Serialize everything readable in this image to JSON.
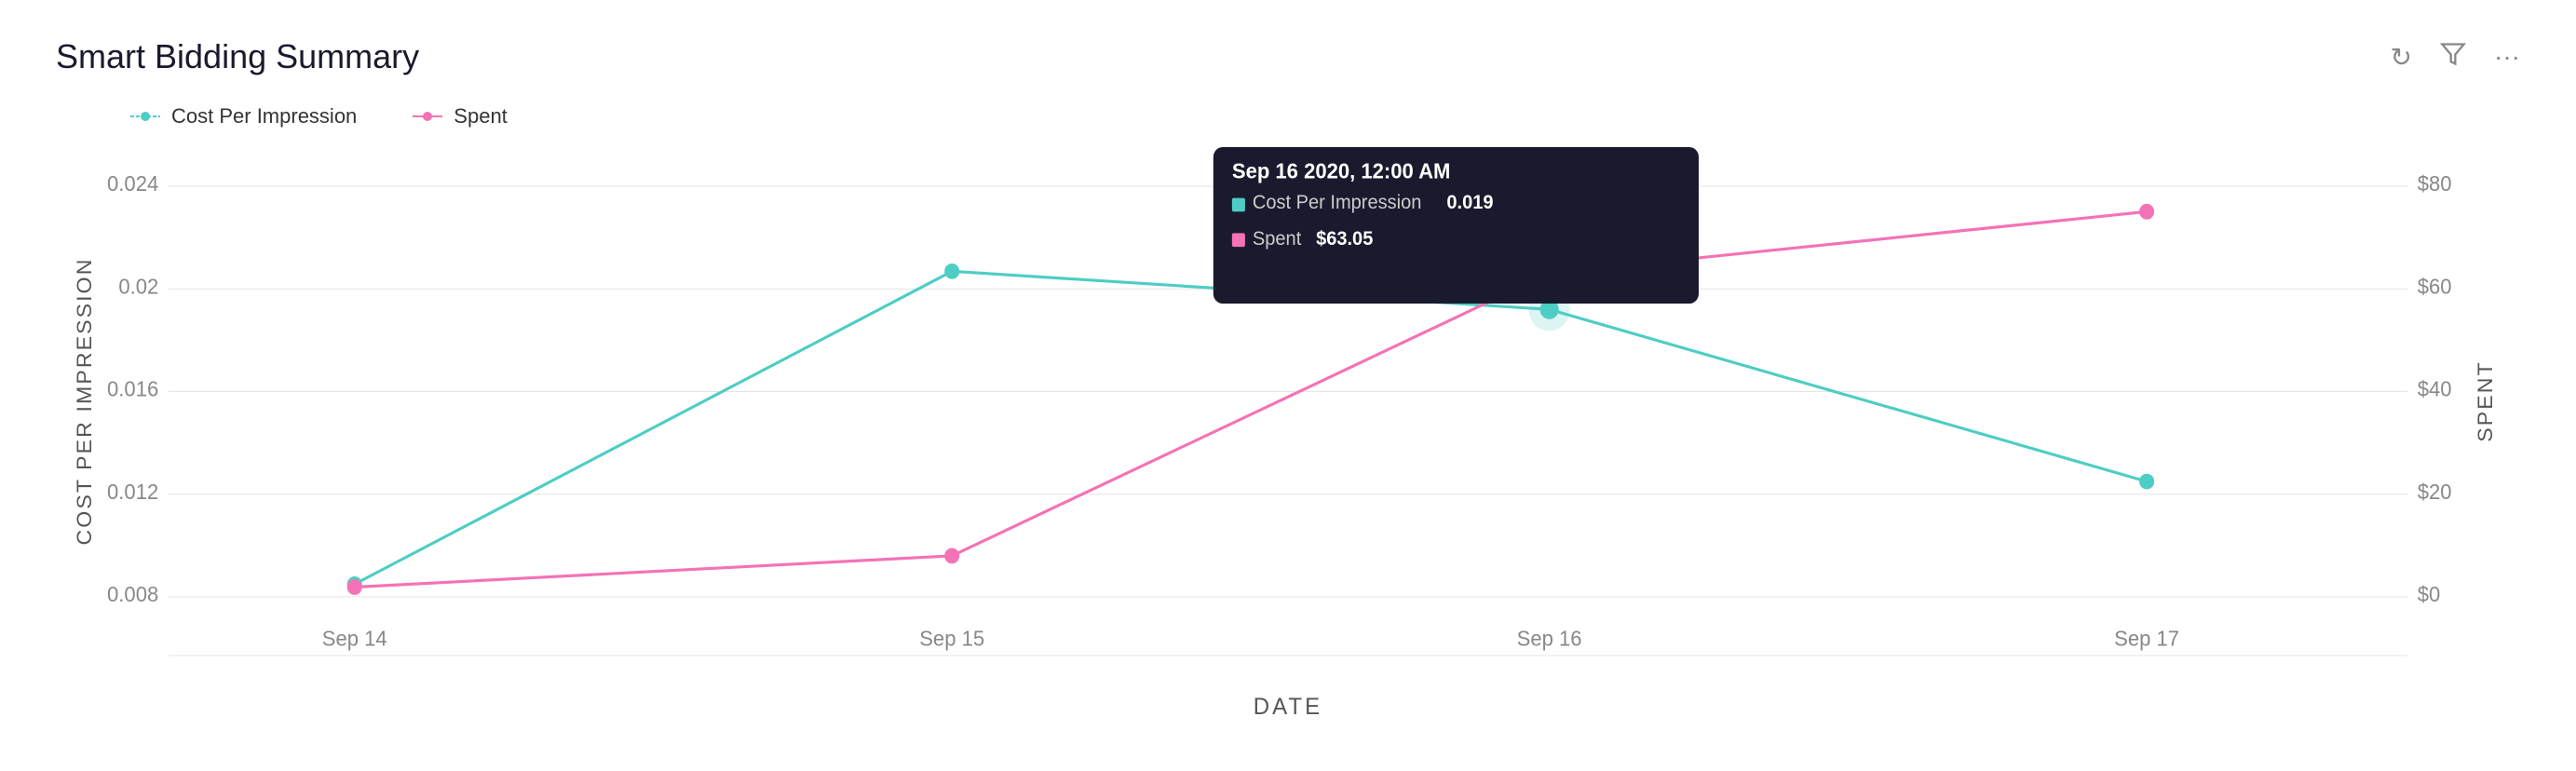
{
  "header": {
    "title": "Smart Bidding Summary"
  },
  "icons": {
    "refresh": "↻",
    "filter": "⊻",
    "more": "···"
  },
  "legend": {
    "items": [
      {
        "label": "Cost Per Impression",
        "color": "#4ecdc4"
      },
      {
        "label": "Spent",
        "color": "#f472b6"
      }
    ]
  },
  "axes": {
    "xLabel": "DATE",
    "yLeftLabel": "COST PER IMPRESSION",
    "yRightLabel": "SPENT",
    "xTicks": [
      "Sep 14",
      "Sep 15",
      "Sep 16",
      "Sep 17"
    ],
    "yLeftTicks": [
      "0.008",
      "0.012",
      "0.016",
      "0.02",
      "0.024"
    ],
    "yRightTicks": [
      "$0",
      "$20",
      "$40",
      "$60",
      "$80"
    ]
  },
  "tooltip": {
    "title": "Sep 16 2020, 12:00 AM",
    "rows": [
      {
        "label": "Cost Per Impression",
        "value": "0.019",
        "color": "#4ecdc4"
      },
      {
        "label": "Spent",
        "value": "$63.05",
        "color": "#f472b6"
      }
    ]
  },
  "series": {
    "cpi": {
      "color": "#4ecdc4",
      "points": [
        {
          "date": "Sep 14",
          "value": 0.0085
        },
        {
          "date": "Sep 15",
          "value": 0.0207
        },
        {
          "date": "Sep 16",
          "value": 0.0192
        },
        {
          "date": "Sep 17",
          "value": 0.0125
        }
      ]
    },
    "spent": {
      "color": "#f472b6",
      "points": [
        {
          "date": "Sep 14",
          "value": 2
        },
        {
          "date": "Sep 15",
          "value": 8
        },
        {
          "date": "Sep 16",
          "value": 63
        },
        {
          "date": "Sep 17",
          "value": 75
        }
      ]
    }
  }
}
